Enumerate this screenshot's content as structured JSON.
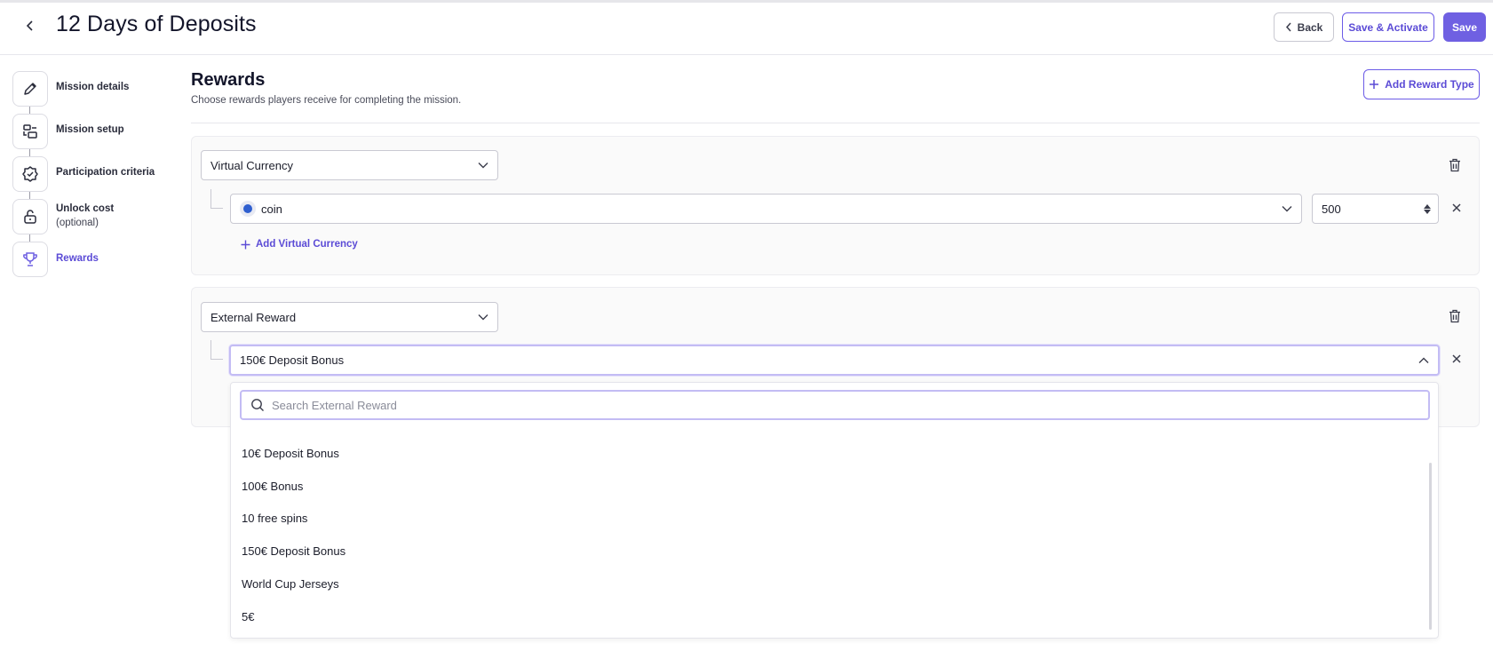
{
  "header": {
    "title": "12 Days of Deposits",
    "back_label": "Back",
    "save_activate_label": "Save & Activate",
    "save_label": "Save"
  },
  "stepper": {
    "steps": [
      {
        "label": "Mission details",
        "icon": "pencil-icon"
      },
      {
        "label": "Mission setup",
        "icon": "setup-icon"
      },
      {
        "label": "Participation criteria",
        "icon": "badge-check-icon"
      },
      {
        "label": "Unlock cost",
        "sub": "(optional)",
        "icon": "lock-open-icon"
      },
      {
        "label": "Rewards",
        "icon": "trophy-icon",
        "active": true
      }
    ]
  },
  "rewards": {
    "title": "Rewards",
    "subtitle": "Choose rewards players receive for completing the mission.",
    "add_type_label": "Add Reward Type",
    "virtual_currency": {
      "type_label": "Virtual Currency",
      "currency": "coin",
      "amount": "500",
      "add_label": "Add Virtual Currency"
    },
    "external_reward": {
      "type_label": "External Reward",
      "selected": "150€ Deposit Bonus",
      "search_placeholder": "Search External Reward",
      "options": [
        "10€ Deposit Bonus",
        "100€ Bonus",
        "10 free spins",
        "150€ Deposit Bonus",
        "World Cup Jerseys",
        "5€"
      ]
    }
  },
  "colors": {
    "accent": "#6f60e2",
    "accent_text": "#5b4bd6",
    "focus_ring": "#c3bcf4",
    "coin": "#2f5fcf"
  }
}
